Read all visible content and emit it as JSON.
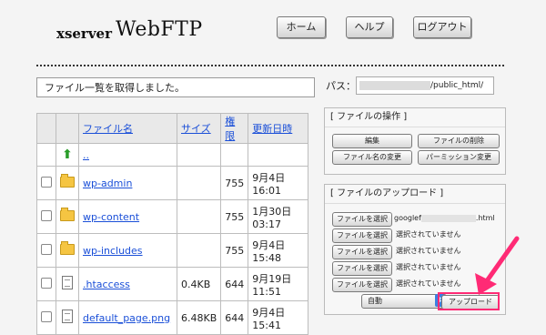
{
  "header": {
    "logo_small": "xserver",
    "logo_big": "WebFTP",
    "buttons": [
      "ホーム",
      "ヘルプ",
      "ログアウト"
    ]
  },
  "message": "ファイル一覧を取得しました。",
  "path": {
    "label": "パス：",
    "value": "/public_html/"
  },
  "table": {
    "headers": {
      "name": "ファイル名",
      "size": "サイズ",
      "perm": "権限",
      "date": "更新日時"
    },
    "parent": "..",
    "rows": [
      {
        "name": "wp-admin",
        "size": "",
        "perm": "755",
        "date1": "9月4日",
        "date2": "16:01",
        "type": "folder"
      },
      {
        "name": "wp-content",
        "size": "",
        "perm": "755",
        "date1": "1月30日",
        "date2": "03:17",
        "type": "folder"
      },
      {
        "name": "wp-includes",
        "size": "",
        "perm": "755",
        "date1": "9月4日",
        "date2": "15:48",
        "type": "folder"
      },
      {
        "name": ".htaccess",
        "size": "0.4KB",
        "perm": "644",
        "date1": "9月19日",
        "date2": "11:51",
        "type": "file"
      },
      {
        "name": "default_page.png",
        "size": "6.48KB",
        "perm": "644",
        "date1": "9月4日",
        "date2": "15:41",
        "type": "file"
      }
    ]
  },
  "ops_panel": {
    "title": "[ ファイルの操作 ]",
    "buttons": [
      "編集",
      "ファイルの削除",
      "ファイル名の変更",
      "パーミッション変更"
    ]
  },
  "upload_panel": {
    "title": "[ ファイルのアップロード ]",
    "select_label": "ファイルを選択",
    "first_file_prefix": "googlef",
    "first_file_suffix": ".html",
    "not_selected": "選択されていません",
    "mode": "自動",
    "upload_button": "アップロード"
  },
  "colors": {
    "link": "#1a4fd8",
    "highlight": "#ff2a75"
  }
}
